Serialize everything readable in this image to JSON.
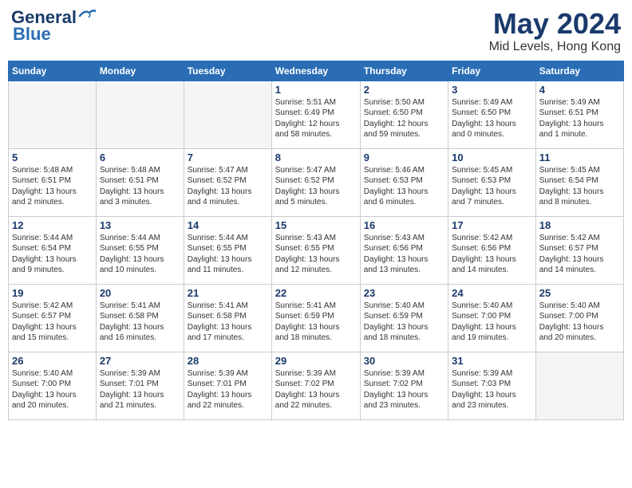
{
  "header": {
    "logo_line1": "General",
    "logo_line2": "Blue",
    "month": "May 2024",
    "location": "Mid Levels, Hong Kong"
  },
  "days_of_week": [
    "Sunday",
    "Monday",
    "Tuesday",
    "Wednesday",
    "Thursday",
    "Friday",
    "Saturday"
  ],
  "weeks": [
    [
      {
        "day": "",
        "info": ""
      },
      {
        "day": "",
        "info": ""
      },
      {
        "day": "",
        "info": ""
      },
      {
        "day": "1",
        "info": "Sunrise: 5:51 AM\nSunset: 6:49 PM\nDaylight: 12 hours\nand 58 minutes."
      },
      {
        "day": "2",
        "info": "Sunrise: 5:50 AM\nSunset: 6:50 PM\nDaylight: 12 hours\nand 59 minutes."
      },
      {
        "day": "3",
        "info": "Sunrise: 5:49 AM\nSunset: 6:50 PM\nDaylight: 13 hours\nand 0 minutes."
      },
      {
        "day": "4",
        "info": "Sunrise: 5:49 AM\nSunset: 6:51 PM\nDaylight: 13 hours\nand 1 minute."
      }
    ],
    [
      {
        "day": "5",
        "info": "Sunrise: 5:48 AM\nSunset: 6:51 PM\nDaylight: 13 hours\nand 2 minutes."
      },
      {
        "day": "6",
        "info": "Sunrise: 5:48 AM\nSunset: 6:51 PM\nDaylight: 13 hours\nand 3 minutes."
      },
      {
        "day": "7",
        "info": "Sunrise: 5:47 AM\nSunset: 6:52 PM\nDaylight: 13 hours\nand 4 minutes."
      },
      {
        "day": "8",
        "info": "Sunrise: 5:47 AM\nSunset: 6:52 PM\nDaylight: 13 hours\nand 5 minutes."
      },
      {
        "day": "9",
        "info": "Sunrise: 5:46 AM\nSunset: 6:53 PM\nDaylight: 13 hours\nand 6 minutes."
      },
      {
        "day": "10",
        "info": "Sunrise: 5:45 AM\nSunset: 6:53 PM\nDaylight: 13 hours\nand 7 minutes."
      },
      {
        "day": "11",
        "info": "Sunrise: 5:45 AM\nSunset: 6:54 PM\nDaylight: 13 hours\nand 8 minutes."
      }
    ],
    [
      {
        "day": "12",
        "info": "Sunrise: 5:44 AM\nSunset: 6:54 PM\nDaylight: 13 hours\nand 9 minutes."
      },
      {
        "day": "13",
        "info": "Sunrise: 5:44 AM\nSunset: 6:55 PM\nDaylight: 13 hours\nand 10 minutes."
      },
      {
        "day": "14",
        "info": "Sunrise: 5:44 AM\nSunset: 6:55 PM\nDaylight: 13 hours\nand 11 minutes."
      },
      {
        "day": "15",
        "info": "Sunrise: 5:43 AM\nSunset: 6:55 PM\nDaylight: 13 hours\nand 12 minutes."
      },
      {
        "day": "16",
        "info": "Sunrise: 5:43 AM\nSunset: 6:56 PM\nDaylight: 13 hours\nand 13 minutes."
      },
      {
        "day": "17",
        "info": "Sunrise: 5:42 AM\nSunset: 6:56 PM\nDaylight: 13 hours\nand 14 minutes."
      },
      {
        "day": "18",
        "info": "Sunrise: 5:42 AM\nSunset: 6:57 PM\nDaylight: 13 hours\nand 14 minutes."
      }
    ],
    [
      {
        "day": "19",
        "info": "Sunrise: 5:42 AM\nSunset: 6:57 PM\nDaylight: 13 hours\nand 15 minutes."
      },
      {
        "day": "20",
        "info": "Sunrise: 5:41 AM\nSunset: 6:58 PM\nDaylight: 13 hours\nand 16 minutes."
      },
      {
        "day": "21",
        "info": "Sunrise: 5:41 AM\nSunset: 6:58 PM\nDaylight: 13 hours\nand 17 minutes."
      },
      {
        "day": "22",
        "info": "Sunrise: 5:41 AM\nSunset: 6:59 PM\nDaylight: 13 hours\nand 18 minutes."
      },
      {
        "day": "23",
        "info": "Sunrise: 5:40 AM\nSunset: 6:59 PM\nDaylight: 13 hours\nand 18 minutes."
      },
      {
        "day": "24",
        "info": "Sunrise: 5:40 AM\nSunset: 7:00 PM\nDaylight: 13 hours\nand 19 minutes."
      },
      {
        "day": "25",
        "info": "Sunrise: 5:40 AM\nSunset: 7:00 PM\nDaylight: 13 hours\nand 20 minutes."
      }
    ],
    [
      {
        "day": "26",
        "info": "Sunrise: 5:40 AM\nSunset: 7:00 PM\nDaylight: 13 hours\nand 20 minutes."
      },
      {
        "day": "27",
        "info": "Sunrise: 5:39 AM\nSunset: 7:01 PM\nDaylight: 13 hours\nand 21 minutes."
      },
      {
        "day": "28",
        "info": "Sunrise: 5:39 AM\nSunset: 7:01 PM\nDaylight: 13 hours\nand 22 minutes."
      },
      {
        "day": "29",
        "info": "Sunrise: 5:39 AM\nSunset: 7:02 PM\nDaylight: 13 hours\nand 22 minutes."
      },
      {
        "day": "30",
        "info": "Sunrise: 5:39 AM\nSunset: 7:02 PM\nDaylight: 13 hours\nand 23 minutes."
      },
      {
        "day": "31",
        "info": "Sunrise: 5:39 AM\nSunset: 7:03 PM\nDaylight: 13 hours\nand 23 minutes."
      },
      {
        "day": "",
        "info": ""
      }
    ]
  ]
}
